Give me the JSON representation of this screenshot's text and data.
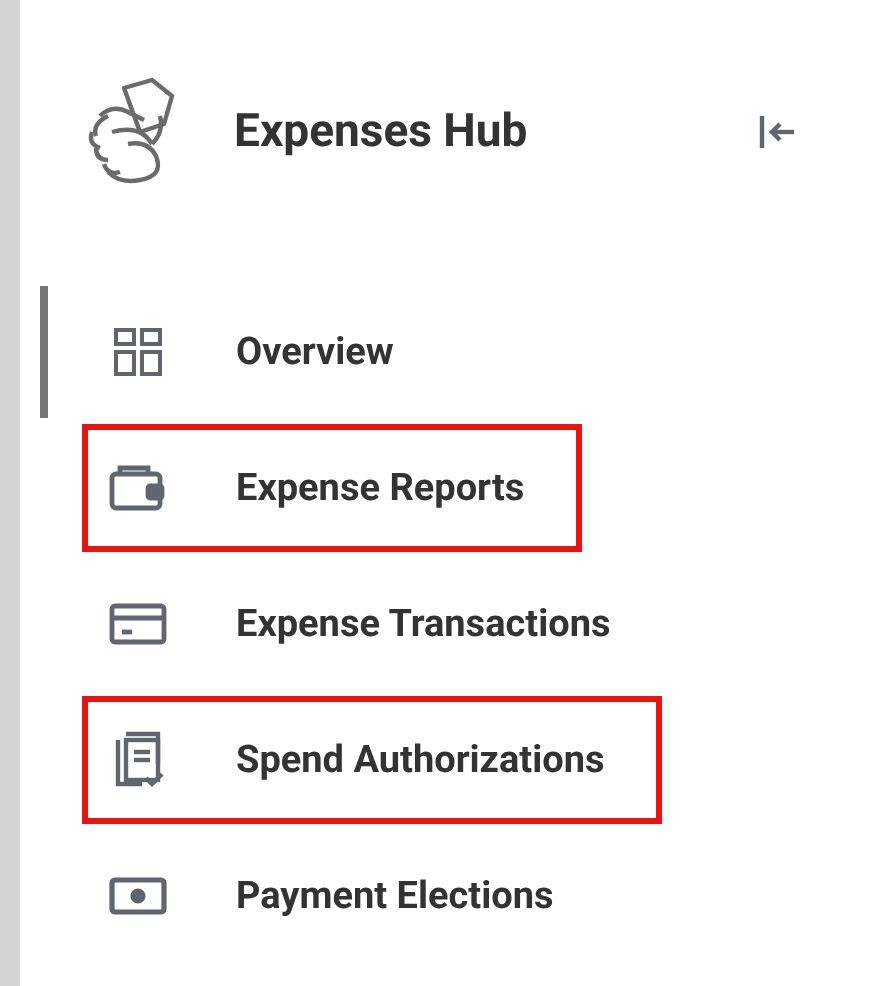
{
  "header": {
    "title": "Expenses Hub"
  },
  "nav_items": [
    {
      "label": "Overview",
      "kind": "grid",
      "selected": true,
      "highlighted": false
    },
    {
      "label": "Expense Reports",
      "kind": "wallet",
      "selected": false,
      "highlighted": true
    },
    {
      "label": "Expense Transactions",
      "kind": "card",
      "selected": false,
      "highlighted": false
    },
    {
      "label": "Spend Authorizations",
      "kind": "documents",
      "selected": false,
      "highlighted": true
    },
    {
      "label": "Payment Elections",
      "kind": "cash",
      "selected": false,
      "highlighted": false
    }
  ]
}
